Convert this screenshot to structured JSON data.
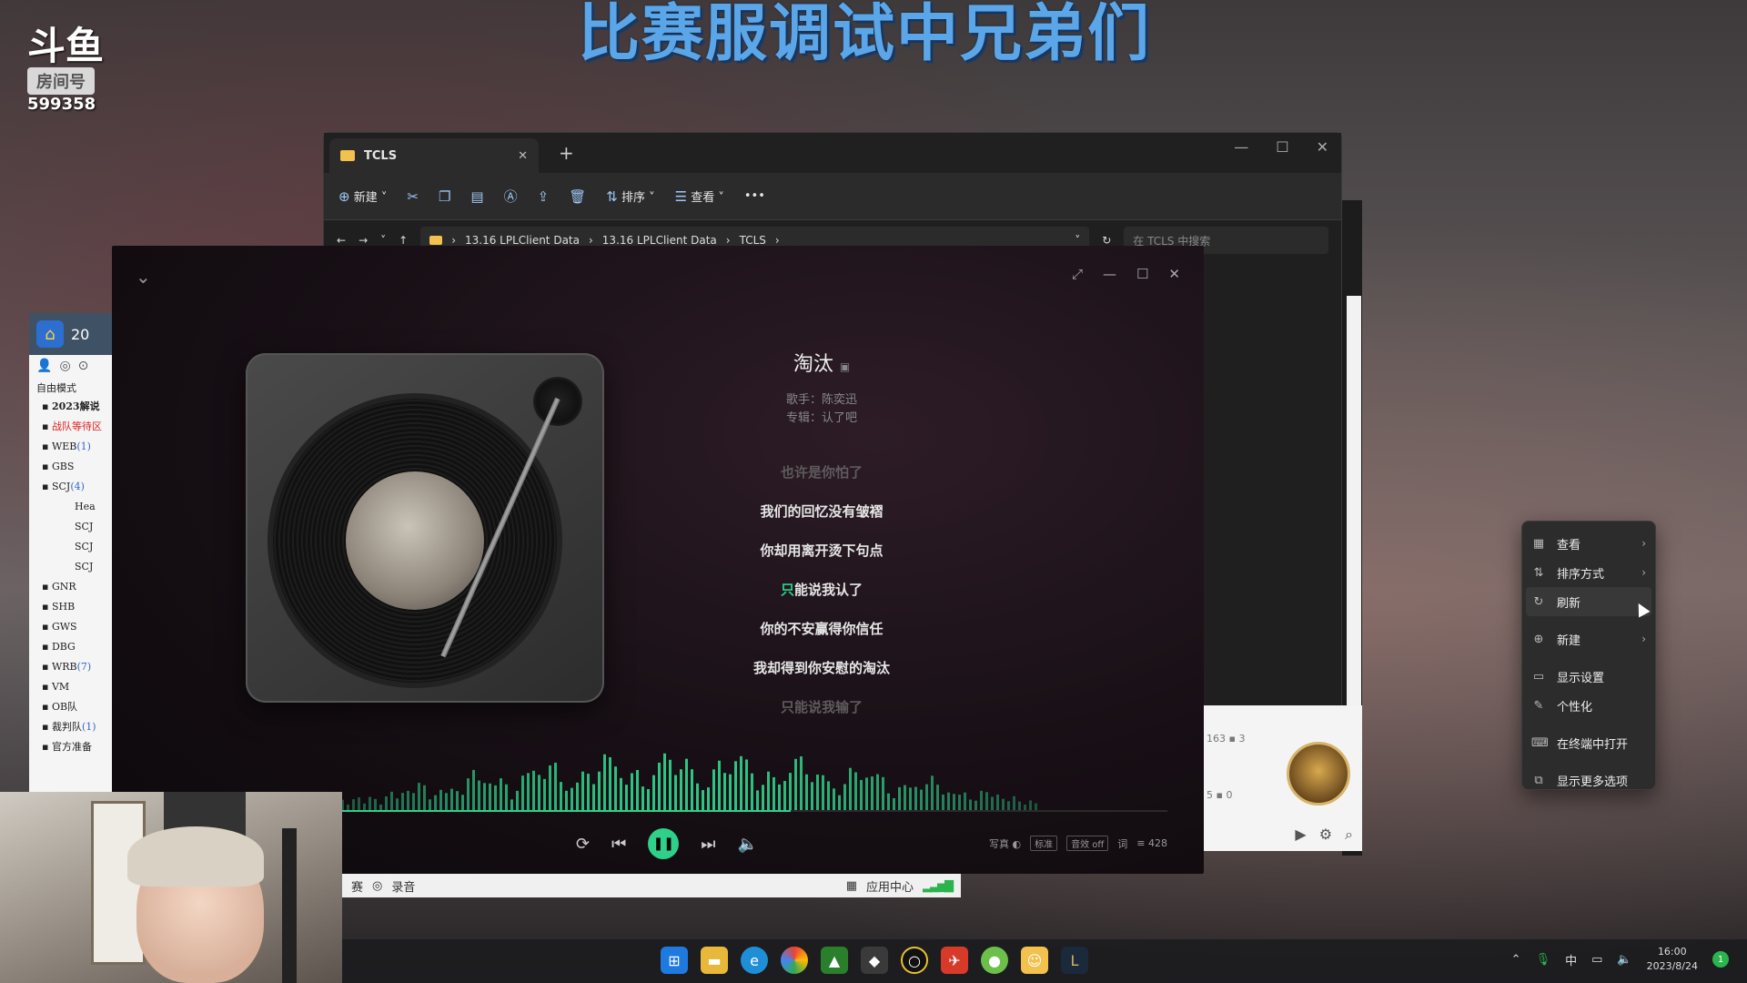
{
  "overlay": {
    "banner": "比赛服调试中兄弟们",
    "logo_mark": "斗鱼",
    "logo_room": "房间号",
    "room_number": "599358"
  },
  "explorer": {
    "tab_title": "TCLS",
    "toolbar": {
      "new": "新建",
      "sort": "排序",
      "view": "查看"
    },
    "path": [
      "13.16 LPLClient Data",
      "13.16 LPLClient Data",
      "TCLS"
    ],
    "search_placeholder": "在 TCLS 中搜索"
  },
  "qq": {
    "head_text": "20",
    "mode": "自由模式",
    "groups": [
      {
        "label": "2023解说",
        "style": "bold"
      },
      {
        "label": "战队等待区",
        "style": "red"
      },
      {
        "label": "WEB",
        "count": "(1)"
      },
      {
        "label": "GBS"
      },
      {
        "label": "SCJ",
        "count": "(4)"
      },
      {
        "label": "Hea",
        "sub": true
      },
      {
        "label": "SCJ",
        "sub": true
      },
      {
        "label": "SCJ",
        "sub": true
      },
      {
        "label": "SCJ",
        "sub": true
      },
      {
        "label": "GNR"
      },
      {
        "label": "SHB"
      },
      {
        "label": "GWS"
      },
      {
        "label": "DBG"
      },
      {
        "label": "WRB",
        "count": "(7)"
      },
      {
        "label": "VM"
      },
      {
        "label": "OB队"
      },
      {
        "label": "裁判队",
        "count": "(1)"
      },
      {
        "label": "官方准备"
      }
    ]
  },
  "user_card": {
    "stat1": "163",
    "stat1b": "3",
    "stat2": "5",
    "stat2b": "0"
  },
  "player": {
    "title": "淘汰",
    "singer_line": "歌手：陈奕迅",
    "album_line": "专辑：认了吧",
    "lyrics": [
      {
        "text": "也许是你怕了",
        "state": "dim"
      },
      {
        "text": "我们的回忆没有皱褶",
        "state": "normal"
      },
      {
        "text": "你却用离开烫下句点",
        "state": "normal"
      },
      {
        "text_hl": "只",
        "text": "能说我认了",
        "state": "active"
      },
      {
        "text": "你的不安赢得你信任",
        "state": "normal"
      },
      {
        "text": "我却得到你安慰的淘汰",
        "state": "normal"
      },
      {
        "text": "只能说我输了",
        "state": "dim"
      }
    ],
    "progress": 0.55,
    "right_ctrls": {
      "realistic": "写真",
      "quality": "标准",
      "effect": "音效 off",
      "lyric": "词",
      "count": "428"
    }
  },
  "rec_bar": {
    "left_cut": "赛",
    "record": "录音",
    "app_center": "应用中心"
  },
  "context_menu": {
    "items": [
      {
        "icon": "grid-icon",
        "label": "查看",
        "submenu": true
      },
      {
        "icon": "sort-icon",
        "label": "排序方式",
        "submenu": true
      },
      {
        "icon": "refresh-icon",
        "label": "刷新",
        "submenu": false,
        "hover": true
      },
      {
        "icon": "new-icon",
        "label": "新建",
        "submenu": true
      },
      {
        "icon": "display-icon",
        "label": "显示设置",
        "submenu": false
      },
      {
        "icon": "brush-icon",
        "label": "个性化",
        "submenu": false
      },
      {
        "icon": "terminal-icon",
        "label": "在终端中打开",
        "submenu": false
      },
      {
        "icon": "more-icon",
        "label": "显示更多选项",
        "submenu": false
      }
    ]
  },
  "taskbar": {
    "tray_lang": "中",
    "time": "16:00",
    "date": "2023/8/24",
    "notif": "1"
  },
  "colors": {
    "accent": "#2fd08a",
    "banner": "#5aa6e8"
  }
}
